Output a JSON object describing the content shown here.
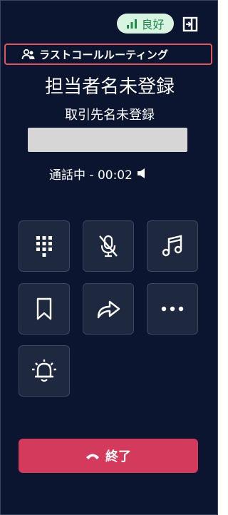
{
  "header": {
    "quality_label": "良好",
    "quality_color": "#1f8a4c",
    "quality_icon": "signal-bars-icon",
    "exit_icon": "panel-exit-icon"
  },
  "routing": {
    "label": "ラストコールルーティング",
    "icon": "users-icon",
    "highlight_color": "#e0565f"
  },
  "caller": {
    "contact_name": "担当者名未登録",
    "company_name": "取引先名未登録"
  },
  "call": {
    "status": "通話中 - 00:02",
    "speaker_icon": "speaker-icon"
  },
  "controls": [
    {
      "name": "keypad",
      "icon": "keypad-icon"
    },
    {
      "name": "mute",
      "icon": "mic-off-icon"
    },
    {
      "name": "hold-music",
      "icon": "music-note-icon"
    },
    {
      "name": "bookmark",
      "icon": "bookmark-icon"
    },
    {
      "name": "transfer",
      "icon": "forward-arrow-icon"
    },
    {
      "name": "more",
      "icon": "more-dots-icon"
    },
    {
      "name": "alert",
      "icon": "alarm-bell-icon"
    }
  ],
  "end_call": {
    "label": "終了",
    "icon": "hang-up-icon",
    "color": "#d33a5b"
  },
  "theme": {
    "background": "#0b1530",
    "button_bg": "#1e283f"
  }
}
